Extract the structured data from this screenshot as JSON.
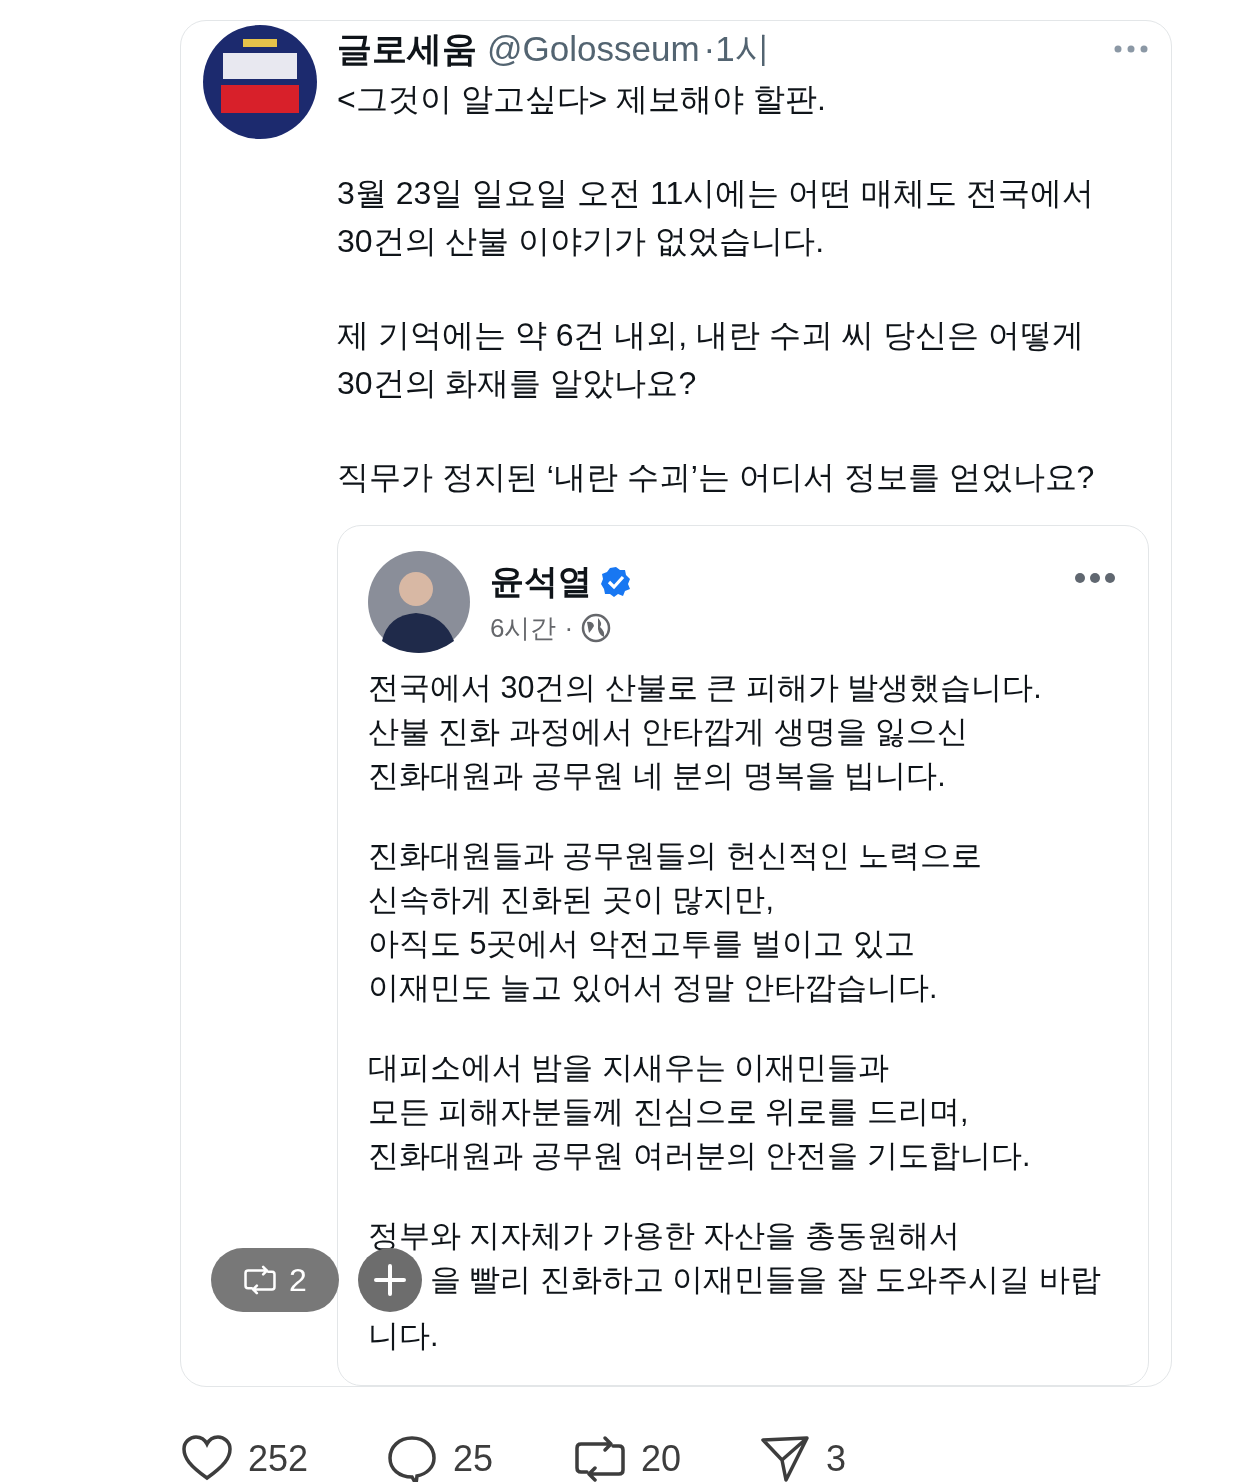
{
  "post": {
    "author": "글로세움",
    "handle": "@Golosseum",
    "time": "·1시",
    "paragraphs": [
      [
        "<그것이 알고싶다> 제보해야 할판."
      ],
      [
        "3월 23일 일요일 오전 11시에는 어떤 매체도 전국에서",
        "30건의 산불 이야기가 없었습니다."
      ],
      [
        "제 기억에는 약 6건 내외, 내란 수괴 씨 당신은 어떻게",
        "30건의 화재를 알았나요?"
      ],
      [
        "직무가 정지된 ‘내란 수괴’는 어디서 정보를 얻었나요?"
      ]
    ],
    "quote": {
      "author": "윤석열",
      "verified": true,
      "time": "6시간",
      "dot": "·",
      "paragraphs": [
        [
          "전국에서 30건의 산불로 큰 피해가 발생했습니다.",
          "산불 진화 과정에서 안타깝게 생명을 잃으신",
          "진화대원과 공무원 네 분의 명복을 빕니다."
        ],
        [
          "진화대원들과 공무원들의 헌신적인 노력으로",
          "신속하게 진화된 곳이 많지만,",
          "아직도 5곳에서 악전고투를 벌이고 있고",
          "이재민도 늘고 있어서 정말 안타깝습니다."
        ],
        [
          "대피소에서 밤을 지새우는 이재민들과",
          "모든 피해자분들께 진심으로 위로를 드리며,",
          "진화대원과 공무원 여러분의 안전을 기도합니다."
        ],
        [
          "정부와 지자체가 가용한 자산을 총동원해서",
          "을 빨리 진화하고 이재민들을 잘 도와주시길 바랍",
          "니다."
        ]
      ]
    }
  },
  "overlay": {
    "repost_count": "2"
  },
  "actions": [
    {
      "kind": "like",
      "count": "252"
    },
    {
      "kind": "reply",
      "count": "25"
    },
    {
      "kind": "repost",
      "count": "20"
    },
    {
      "kind": "share",
      "count": "3"
    }
  ]
}
